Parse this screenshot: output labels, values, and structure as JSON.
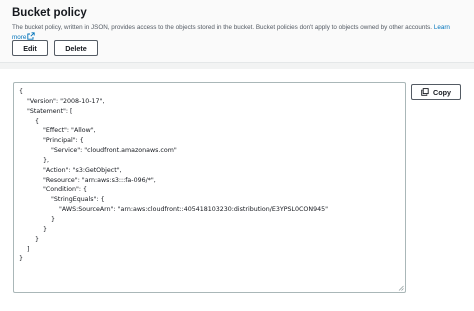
{
  "section": {
    "title": "Bucket policy",
    "description": "The bucket policy, written in JSON, provides access to the objects stored in the bucket. Bucket policies don't apply to objects owned by other accounts.",
    "learn_more_label": "Learn more"
  },
  "actions": {
    "edit_label": "Edit",
    "delete_label": "Delete",
    "copy_label": "Copy"
  },
  "icons": {
    "external_link": "external-link-icon",
    "copy": "copy-icon",
    "resize": "resize-grip-icon"
  },
  "colors": {
    "link": "#0073bb",
    "border": "#aab7b8",
    "background": "#f2f3f3"
  },
  "policy_lines": [
    "{",
    "    \"Version\": \"2008-10-17\",",
    "    \"Statement\": [",
    "        {",
    "            \"Effect\": \"Allow\",",
    "            \"Principal\": {",
    "                \"Service\": \"cloudfront.amazonaws.com\"",
    "            },",
    "            \"Action\": \"s3:GetObject\",",
    "            \"Resource\": \"arn:aws:s3:::fa-096/*\",",
    "            \"Condition\": {",
    "                \"StringEquals\": {",
    "                    \"AWS:SourceArn\": \"arn:aws:cloudfront::405418103230:distribution/E3YPSL0CON945\"",
    "                }",
    "            }",
    "        }",
    "    ]",
    "}"
  ]
}
